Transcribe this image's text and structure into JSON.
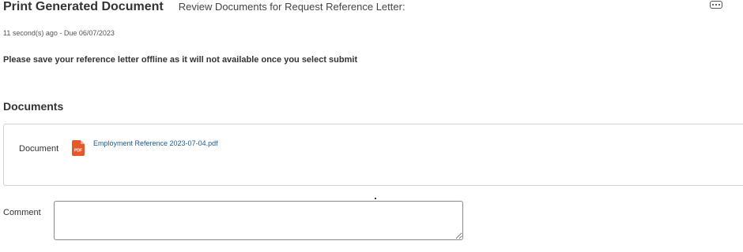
{
  "header": {
    "title": "Print Generated Document",
    "subtitle": "Review Documents for Request Reference Letter:",
    "more_icon": "ellipsis-icon"
  },
  "meta": {
    "line": "11 second(s) ago - Due 06/07/2023"
  },
  "instruction": "Please save your reference letter offline as it will not available once you select submit",
  "documents": {
    "heading": "Documents",
    "field_label": "Document",
    "file_icon": "pdf-file-icon",
    "icon_text": "PDF",
    "file_name": "Employment Reference 2023-07-04.pdf",
    "colors": {
      "link": "#1a5a96",
      "pdf_icon": "#e8572a"
    }
  },
  "comment": {
    "label": "Comment",
    "value": ""
  }
}
